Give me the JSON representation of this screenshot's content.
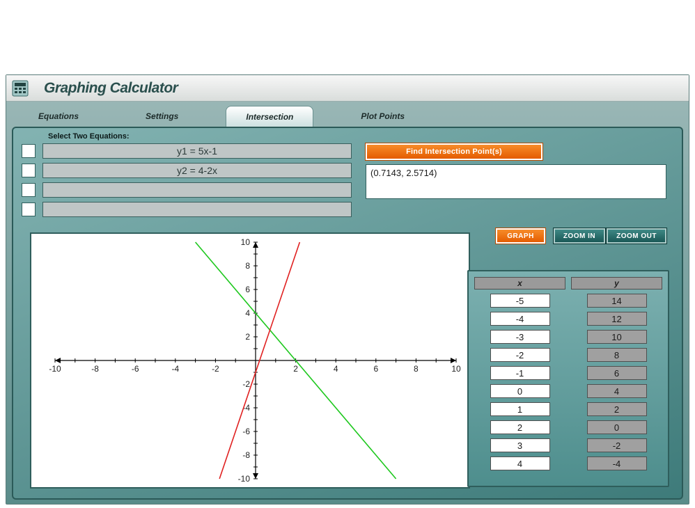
{
  "app": {
    "title": "Graphing Calculator",
    "icon_name": "calculator-icon"
  },
  "tabs": [
    {
      "label": "Equations",
      "active": false
    },
    {
      "label": "Settings",
      "active": false
    },
    {
      "label": "Intersection",
      "active": true
    },
    {
      "label": "Plot Points",
      "active": false
    }
  ],
  "select_label": "Select Two Equations:",
  "equations": [
    {
      "text": "y1 = 5x-1"
    },
    {
      "text": "y2 = 4-2x"
    },
    {
      "text": ""
    },
    {
      "text": ""
    }
  ],
  "buttons": {
    "find": "Find Intersection Point(s)",
    "graph": "GRAPH",
    "zoom_in": "ZOOM IN",
    "zoom_out": "ZOOM OUT"
  },
  "result": "(0.7143, 2.5714)",
  "table": {
    "x_header": "x",
    "y_header": "y",
    "x": [
      "-5",
      "-4",
      "-3",
      "-2",
      "-1",
      "0",
      "1",
      "2",
      "3",
      "4"
    ],
    "y": [
      "14",
      "12",
      "10",
      "8",
      "6",
      "4",
      "2",
      "0",
      "-2",
      "-4"
    ]
  },
  "chart_data": {
    "type": "line",
    "xlabel": "",
    "ylabel": "",
    "xlim": [
      -10,
      10
    ],
    "ylim": [
      -10,
      10
    ],
    "xticks": [
      -10,
      -8,
      -6,
      -4,
      -2,
      2,
      4,
      6,
      8,
      10
    ],
    "yticks": [
      -10,
      -8,
      -6,
      -4,
      -2,
      2,
      4,
      6,
      8,
      10
    ],
    "series": [
      {
        "name": "y2 = 4-2x",
        "color": "#1ec81e",
        "points": [
          [
            -3,
            10
          ],
          [
            7,
            -10
          ]
        ]
      },
      {
        "name": "y1 = 5x-1",
        "color": "#e02020",
        "points": [
          [
            -1.8,
            -10
          ],
          [
            2.2,
            10
          ]
        ]
      }
    ],
    "intersection": {
      "x": 0.7143,
      "y": 2.5714
    }
  }
}
